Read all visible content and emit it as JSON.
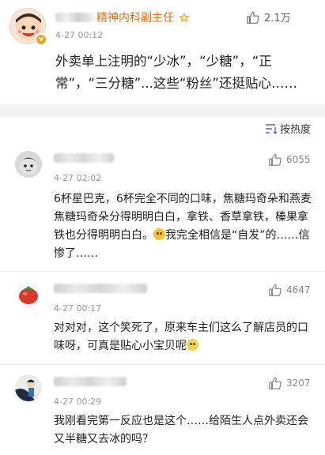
{
  "post": {
    "author_name": "精神内科副主任",
    "time": "4-27 00:12",
    "likes": "2.1万",
    "text": "外卖单上注明的“少冰”，“少糖”，“正常”，“三分糖”...这些“粉丝”还挺贴心……",
    "badge": "v"
  },
  "sort": {
    "label": "按热度"
  },
  "comments": [
    {
      "time": "4-27 02:02",
      "likes": "6055",
      "text_a": "6杯星巴克，6杯完全不同的口味，焦糖玛奇朵和燕麦焦糖玛奇朵分得明明白白，拿铁、香草拿铁，榛果拿铁也分得明明白白。",
      "text_b": "我完全相信是“自发”的……信惨了……"
    },
    {
      "time": "4-27 00:17",
      "likes": "4647",
      "text_a": "对对对，这个笑死了，原来车主们这么了解店员的口味呀，可真是贴心小宝贝呢",
      "text_b": ""
    },
    {
      "time": "4-27 00:29",
      "likes": "3207",
      "text_a": "我刚看完第一反应也是这个……给陌生人点外卖还会又半糖又去冰的吗？",
      "text_b": ""
    }
  ],
  "colors": {
    "name_orange": "#e86b0c",
    "meta_gray": "#999999",
    "badge_gold": "#f0a21f"
  },
  "icons": [
    "thumbs-up-icon",
    "sort-icon",
    "level-badge-icon",
    "verified-badge-icon"
  ]
}
